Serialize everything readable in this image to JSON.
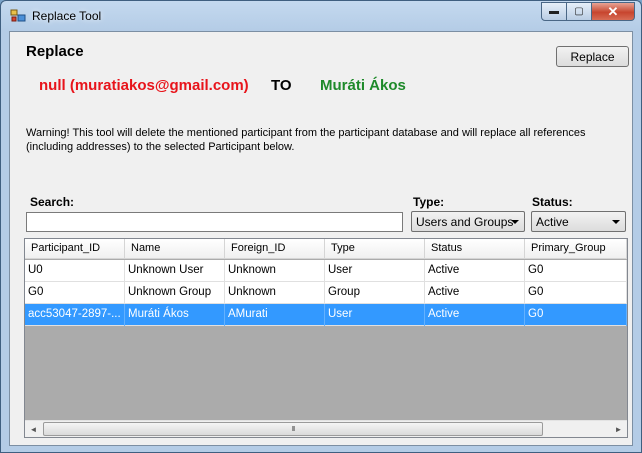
{
  "window": {
    "title": "Replace Tool",
    "buttons": {
      "minimize": "▬",
      "maximize": "▢",
      "close": "✕"
    }
  },
  "header": {
    "heading": "Replace",
    "replace_button": "Replace",
    "from_participant": "null (muratiakos@gmail.com)",
    "to_word": "TO",
    "to_participant": "Muráti Ákos"
  },
  "warning": "Warning! This tool will delete the mentioned participant from the participant database and will replace all references (including addresses) to the selected Participant below.",
  "filters": {
    "search_label": "Search:",
    "search_value": "",
    "type_label": "Type:",
    "type_value": "Users and Groups",
    "status_label": "Status:",
    "status_value": "Active"
  },
  "grid": {
    "columns": [
      "Participant_ID",
      "Name",
      "Foreign_ID",
      "Type",
      "Status",
      "Primary_Group"
    ],
    "rows": [
      {
        "cells": [
          "U0",
          "Unknown User",
          "Unknown",
          "User",
          "Active",
          "G0"
        ],
        "selected": false
      },
      {
        "cells": [
          "G0",
          "Unknown Group",
          "Unknown",
          "Group",
          "Active",
          "G0"
        ],
        "selected": false
      },
      {
        "cells": [
          "acc53047-2897-...",
          "Muráti Ákos",
          "AMurati",
          "User",
          "Active",
          "G0"
        ],
        "selected": true
      }
    ],
    "scroll_left": "◄",
    "scroll_right": "►",
    "thumb_grip": "III"
  },
  "colors": {
    "from_color": "#e8141b",
    "to_color": "#1e8a2a",
    "selection": "#3399ff",
    "grid_empty": "#ababab"
  }
}
